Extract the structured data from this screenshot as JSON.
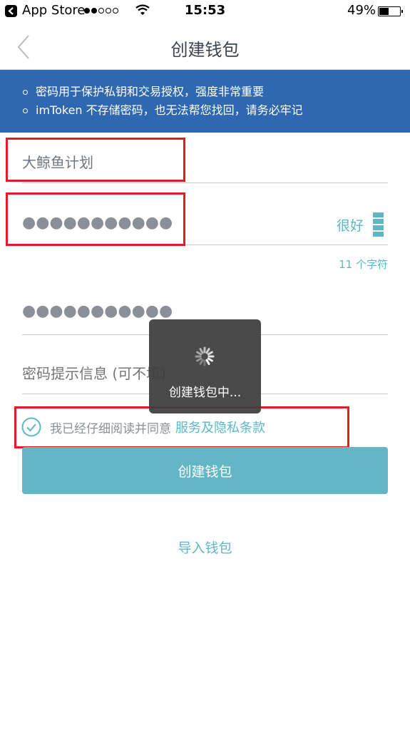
{
  "status_bar": {
    "back_app": "App Store",
    "signal_bars_filled": 2,
    "signal_bars_total": 5,
    "time": "15:53",
    "battery_text": "49%",
    "battery_level": 0.49
  },
  "nav": {
    "title": "创建钱包",
    "back_icon": "chevron-left-icon"
  },
  "banner": {
    "items": [
      "密码用于保护私钥和交易授权，强度非常重要",
      "imToken 不存储密码，也无法帮您找回，请务必牢记"
    ]
  },
  "form": {
    "wallet_name": {
      "value": "大鲸鱼计划"
    },
    "password": {
      "value": "●●●●●●●●●●●",
      "strength_label": "很好",
      "strength_level": 4,
      "strength_max": 4,
      "char_count": "11 个字符"
    },
    "confirm_password": {
      "value": "●●●●●●●●●●●"
    },
    "hint": {
      "placeholder": "密码提示信息 (可不填)"
    }
  },
  "agree": {
    "checked": true,
    "text": "我已经仔细阅读并同意",
    "link": "服务及隐私条款"
  },
  "buttons": {
    "create": "创建钱包",
    "import": "导入钱包"
  },
  "toast": {
    "text": "创建钱包中...",
    "icon": "spinner-icon"
  },
  "colors": {
    "banner": "#2f68b0",
    "accent": "#5fb7c6",
    "button": "#62b6c6",
    "highlight_box": "#e31b23"
  }
}
